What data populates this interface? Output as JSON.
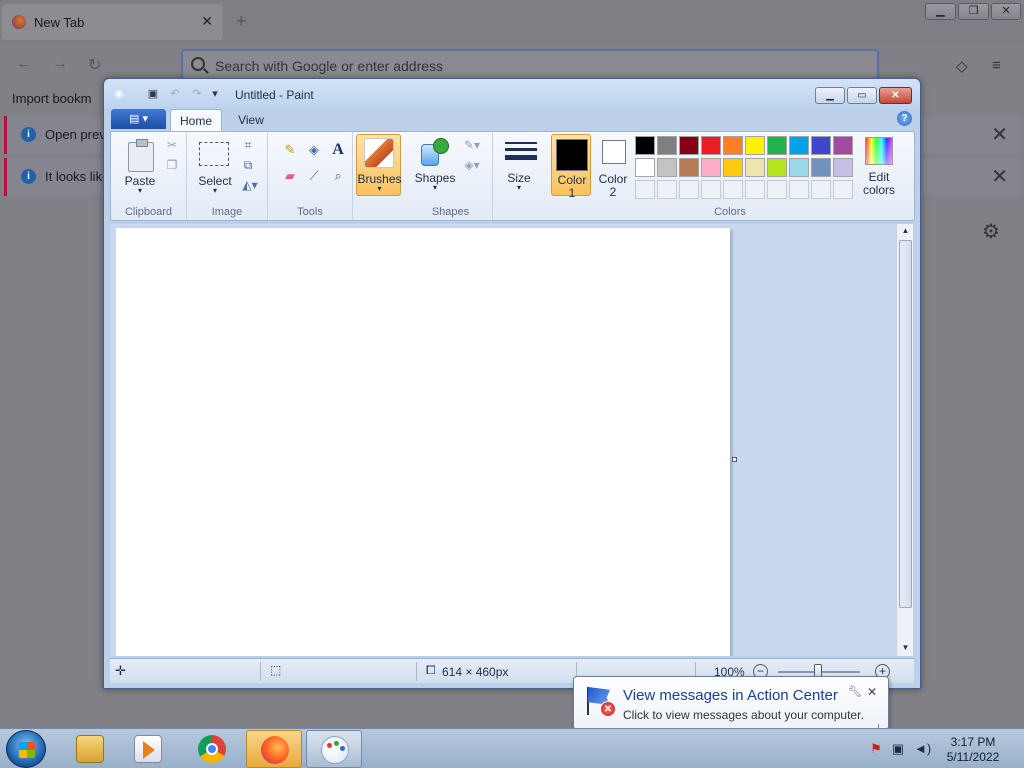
{
  "firefox": {
    "tab_title": "New Tab",
    "tab_close": "✕",
    "new_tab": "+",
    "url_placeholder": "Search with Google or enter address",
    "bookmark_import": "Import bookm",
    "notifications": [
      {
        "text": "Open previ"
      },
      {
        "text": "It looks like"
      }
    ],
    "icons": {
      "back": "←",
      "forward": "→",
      "reload": "↻",
      "pocket": "◇",
      "menu": "≡",
      "gear": "⚙",
      "close": "✕"
    }
  },
  "paint": {
    "title": "Untitled - Paint",
    "tabs": {
      "home": "Home",
      "view": "View"
    },
    "help": "?",
    "groups": {
      "clipboard": "Clipboard",
      "image": "Image",
      "tools": "Tools",
      "shapes": "Shapes",
      "colors": "Colors"
    },
    "buttons": {
      "paste": "Paste",
      "select": "Select",
      "brushes": "Brushes",
      "shapes": "Shapes",
      "size": "Size",
      "color1": "Color\n1",
      "color2": "Color\n2",
      "edit_colors": "Edit\ncolors"
    },
    "color1_value": "#000000",
    "color2_value": "#ffffff",
    "palette_row1": [
      "#000000",
      "#7f7f7f",
      "#880015",
      "#ed1c24",
      "#ff7f27",
      "#fff200",
      "#22b14c",
      "#00a2e8",
      "#3f48cc",
      "#a349a4"
    ],
    "palette_row2": [
      "#ffffff",
      "#c3c3c3",
      "#b97a57",
      "#ffaec9",
      "#ffc90e",
      "#efe4b0",
      "#b5e61d",
      "#99d9ea",
      "#7092be",
      "#c8bfe7"
    ],
    "status": {
      "canvas_size": "614 × 460px",
      "zoom": "100%"
    }
  },
  "balloon": {
    "title": "View messages in Action Center",
    "subtitle": "Click to view messages about your computer."
  },
  "clock": {
    "time": "3:17 PM",
    "date": "5/11/2022"
  }
}
